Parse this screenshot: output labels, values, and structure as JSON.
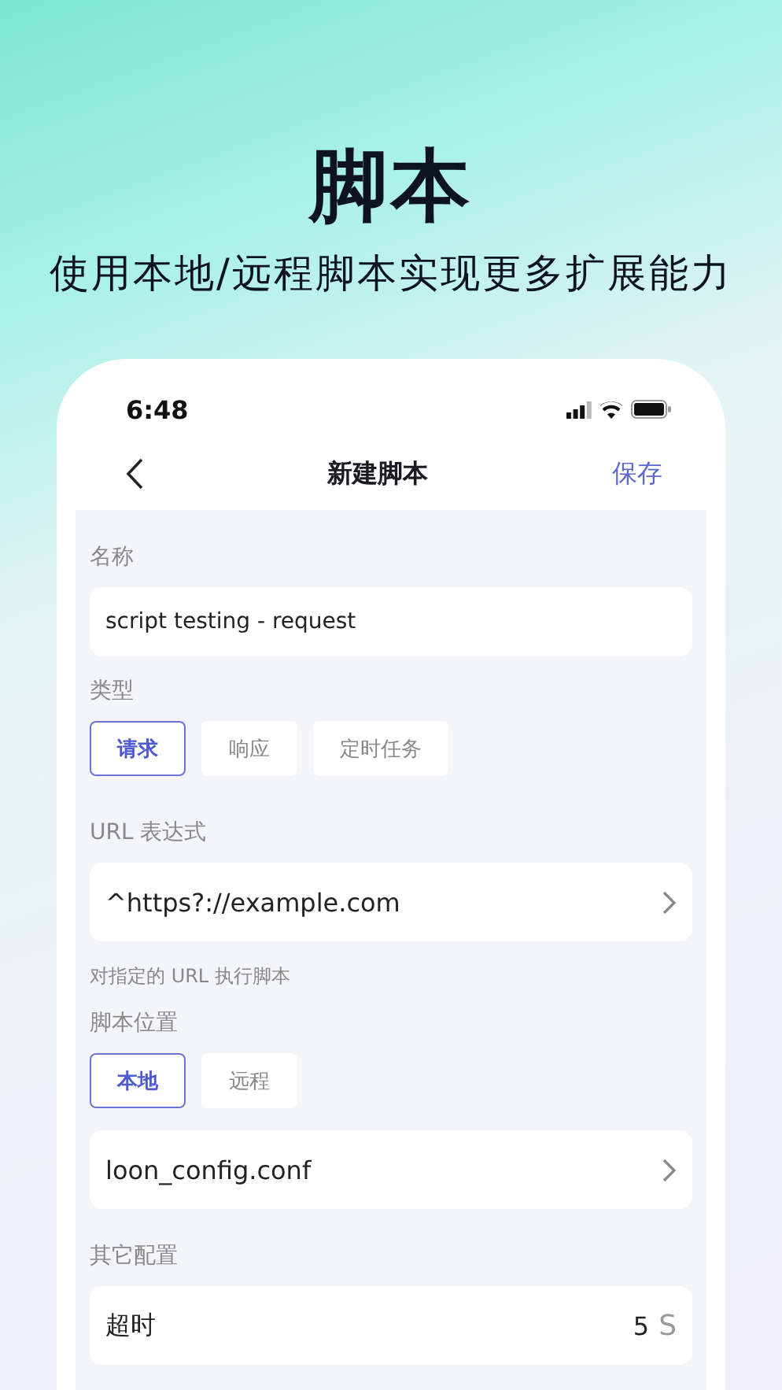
{
  "header": {
    "title": "脚本",
    "subtitle": "使用本地/远程脚本实现更多扩展能力"
  },
  "status_bar": {
    "time": "6:48"
  },
  "nav": {
    "title": "新建脚本",
    "action": "保存"
  },
  "form": [
    {
      "kind": "label",
      "text": "名称"
    },
    {
      "kind": "input",
      "value": "script testing - request"
    },
    {
      "kind": "label",
      "text": "类型"
    },
    {
      "kind": "segments",
      "options": [
        {
          "label": "请求",
          "selected": true
        },
        {
          "label": "响应",
          "selected": false
        },
        {
          "label": "定时任务",
          "selected": false
        }
      ]
    },
    {
      "kind": "label",
      "text": "URL 表达式"
    },
    {
      "kind": "link",
      "value": "^https?://example.com"
    },
    {
      "kind": "hint",
      "text": "对指定的 URL 执行脚本"
    },
    {
      "kind": "label",
      "text": "脚本位置"
    },
    {
      "kind": "segments",
      "options": [
        {
          "label": "本地",
          "selected": true
        },
        {
          "label": "远程",
          "selected": false
        }
      ]
    },
    {
      "kind": "link",
      "value": "loon_config.conf"
    },
    {
      "kind": "label",
      "text": "其它配置"
    },
    {
      "kind": "setting",
      "label": "超时",
      "value": "5",
      "unit": "S"
    }
  ]
}
